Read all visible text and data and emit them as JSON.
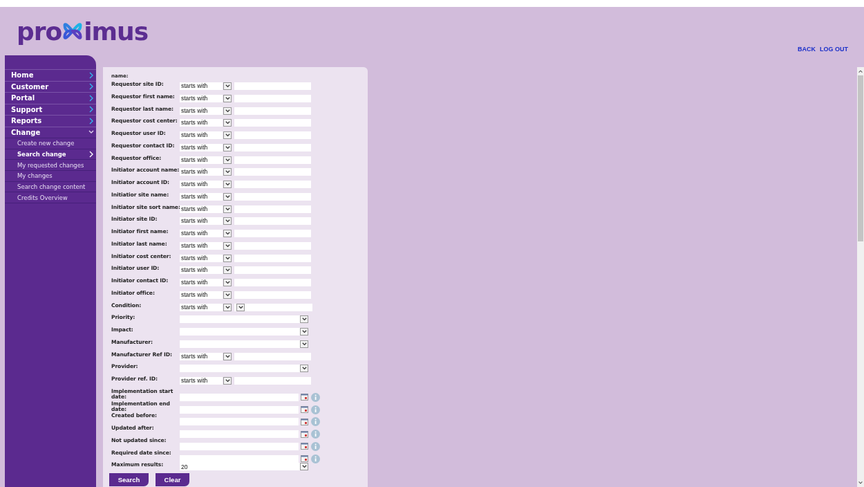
{
  "logo": {
    "before": "pro",
    "after": "imus"
  },
  "top_links": [
    "BACK",
    "LOG OUT"
  ],
  "sidebar": {
    "items": [
      {
        "label": "Home",
        "expanded": false
      },
      {
        "label": "Customer",
        "expanded": false
      },
      {
        "label": "Portal",
        "expanded": false
      },
      {
        "label": "Support",
        "expanded": false
      },
      {
        "label": "Reports",
        "expanded": false
      },
      {
        "label": "Change",
        "expanded": true,
        "children": [
          {
            "label": "Create new change",
            "selected": false
          },
          {
            "label": "Search change",
            "selected": true
          },
          {
            "label": "My requested changes",
            "selected": false
          },
          {
            "label": "My changes",
            "selected": false
          },
          {
            "label": "Search change content",
            "selected": false
          },
          {
            "label": "Credits Overview",
            "selected": false
          }
        ]
      }
    ]
  },
  "form": {
    "cut_label": "name:",
    "rows": [
      {
        "label": "Requestor site ID:",
        "kind": "text",
        "operator": "starts with"
      },
      {
        "label": "Requestor first name:",
        "kind": "text",
        "operator": "starts with"
      },
      {
        "label": "Requestor last name:",
        "kind": "text",
        "operator": "starts with"
      },
      {
        "label": "Requestor cost center:",
        "kind": "text",
        "operator": "starts with"
      },
      {
        "label": "Requestor user ID:",
        "kind": "text",
        "operator": "starts with"
      },
      {
        "label": "Requestor contact ID:",
        "kind": "text",
        "operator": "starts with"
      },
      {
        "label": "Requestor office:",
        "kind": "text",
        "operator": "starts with"
      },
      {
        "label": "Initiator account name:",
        "kind": "text",
        "operator": "starts with"
      },
      {
        "label": "Initiator account ID:",
        "kind": "text",
        "operator": "starts with"
      },
      {
        "label": "Initiatior site name:",
        "kind": "text",
        "operator": "starts with"
      },
      {
        "label": "Initiator site sort name:",
        "kind": "text",
        "operator": "starts with"
      },
      {
        "label": "Initiator site ID:",
        "kind": "text",
        "operator": "starts with"
      },
      {
        "label": "Initiator first name:",
        "kind": "text",
        "operator": "starts with"
      },
      {
        "label": "Initiator last name:",
        "kind": "text",
        "operator": "starts with"
      },
      {
        "label": "Initiator cost center:",
        "kind": "text",
        "operator": "starts with"
      },
      {
        "label": "Initiator user ID:",
        "kind": "text",
        "operator": "starts with"
      },
      {
        "label": "Initiator contact ID:",
        "kind": "text",
        "operator": "starts with"
      },
      {
        "label": "Initiator office:",
        "kind": "text",
        "operator": "starts with"
      },
      {
        "label": "Condition:",
        "kind": "condition",
        "operator": "starts with"
      },
      {
        "label": "Priority:",
        "kind": "select"
      },
      {
        "label": "Impact:",
        "kind": "select"
      },
      {
        "label": "Manufacturer:",
        "kind": "select"
      },
      {
        "label": "Manufacturer Ref ID:",
        "kind": "text",
        "operator": "starts with"
      },
      {
        "label": "Provider:",
        "kind": "select"
      },
      {
        "label": "Provider ref. ID:",
        "kind": "text",
        "operator": "starts with"
      },
      {
        "label": "Implementation start date:",
        "kind": "date"
      },
      {
        "label": "Implementation end date:",
        "kind": "date"
      },
      {
        "label": "Created before:",
        "kind": "date"
      },
      {
        "label": "Updated after:",
        "kind": "date"
      },
      {
        "label": "Not updated since:",
        "kind": "date"
      },
      {
        "label": "Required date since:",
        "kind": "date"
      },
      {
        "label": "Maximum results:",
        "kind": "select",
        "value": "20"
      }
    ],
    "buttons": [
      "Search",
      "Clear"
    ]
  }
}
